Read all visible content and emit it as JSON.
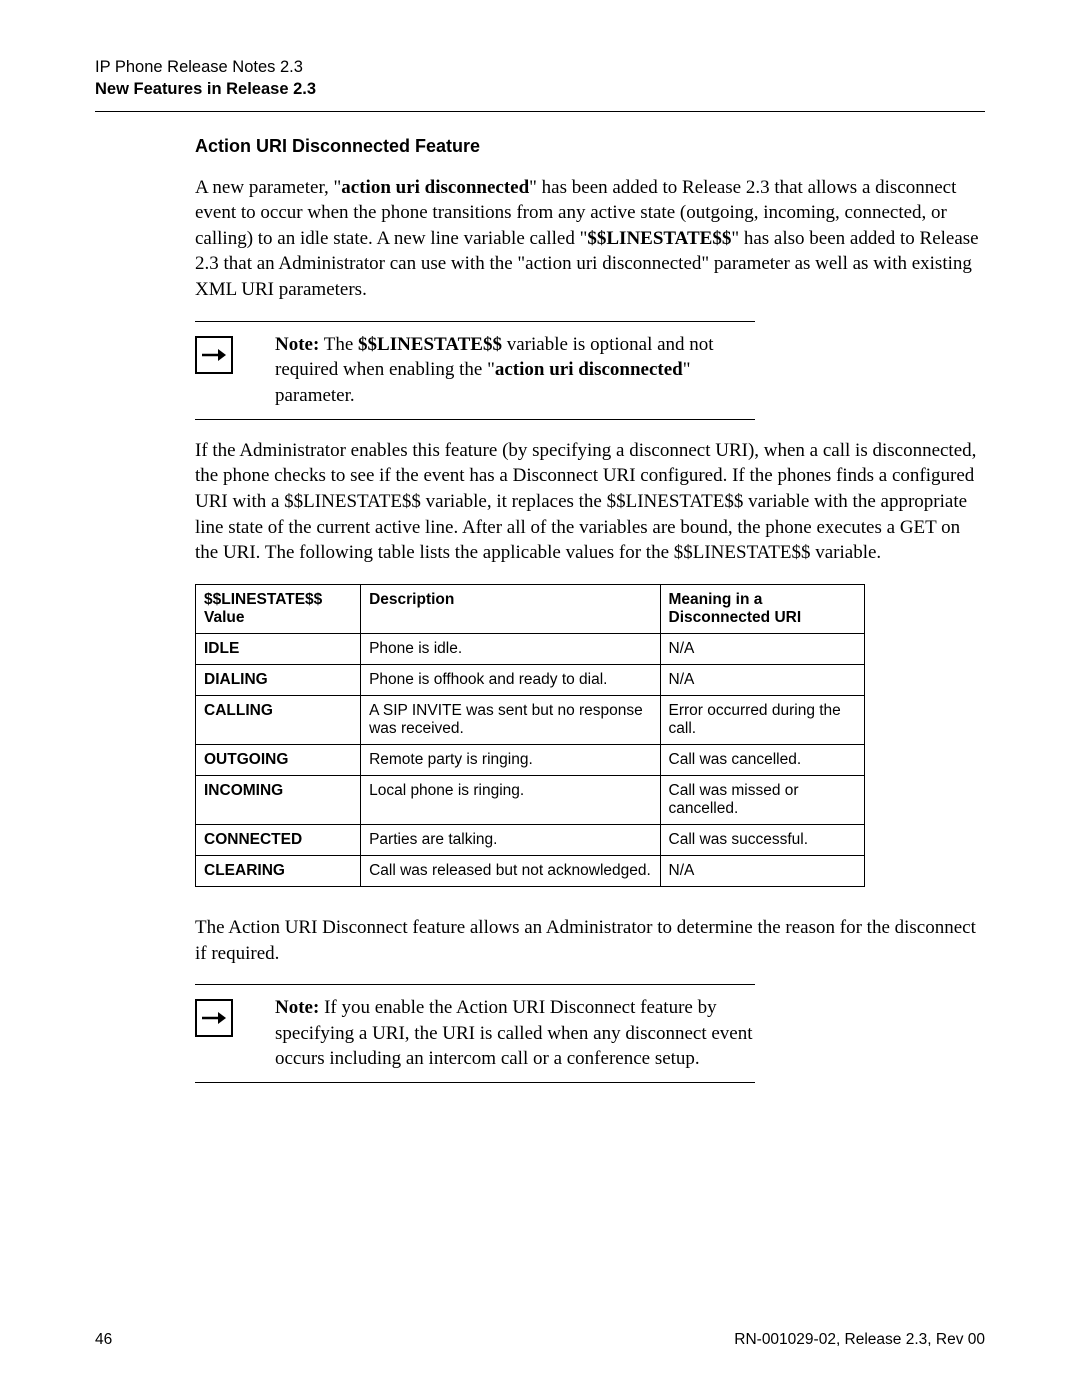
{
  "header": {
    "line1": "IP Phone Release Notes 2.3",
    "line2": "New Features in Release 2.3"
  },
  "section_title": "Action URI Disconnected Feature",
  "para1": {
    "t1": "A new parameter, \"",
    "b1": "action uri disconnected",
    "t2": "\" has been added to Release 2.3 that allows a disconnect event to occur when the phone transitions from any active state (outgoing, incoming, connected, or calling) to an idle state. A new line variable called \"",
    "b2": "$$LINESTATE$$",
    "t3": "\" has also been added to Release 2.3 that an Administrator can use with the \"action uri disconnected\" parameter as well as with existing XML URI parameters."
  },
  "note1": {
    "label": "Note:",
    "t1": " The ",
    "b1": "$$LINESTATE$$",
    "t2": " variable is optional and not required when enabling the \"",
    "b2": "action uri disconnected",
    "t3": "\" parameter."
  },
  "para2": "If the Administrator enables this feature (by specifying a disconnect URI), when a call is disconnected, the phone checks to see if the event has a Disconnect URI configured. If the phones finds a configured URI with a $$LINESTATE$$ variable, it replaces the $$LINESTATE$$ variable with the appropriate line state of the current active line. After all of the variables are bound, the phone executes a GET on the URI. The following table lists the applicable values for the $$LINESTATE$$ variable.",
  "table": {
    "headers": [
      "$$LINESTATE$$ Value",
      "Description",
      "Meaning in a Disconnected URI"
    ],
    "rows": [
      {
        "value": "IDLE",
        "desc": "Phone is idle.",
        "meaning": "N/A",
        "center": true
      },
      {
        "value": "DIALING",
        "desc": "Phone is offhook and ready to dial.",
        "meaning": "N/A",
        "center": true
      },
      {
        "value": "CALLING",
        "desc": "A SIP INVITE was sent but no response was received.",
        "meaning": "Error occurred during the call.",
        "center": false
      },
      {
        "value": "OUTGOING",
        "desc": "Remote party is ringing.",
        "meaning": "Call was cancelled.",
        "center": false
      },
      {
        "value": "INCOMING",
        "desc": "Local phone is ringing.",
        "meaning": "Call was missed or cancelled.",
        "center": false
      },
      {
        "value": "CONNECTED",
        "desc": "Parties are talking.",
        "meaning": "Call was successful.",
        "center": false
      },
      {
        "value": "CLEARING",
        "desc": "Call was released but not acknowledged.",
        "meaning": "N/A",
        "center": true
      }
    ]
  },
  "para3": "The Action URI Disconnect feature allows an Administrator to determine the reason for the disconnect if required.",
  "note2": {
    "label": "Note:",
    "text": " If you enable the Action URI Disconnect feature by specifying a URI, the URI is called when any disconnect event occurs including an intercom call or a conference setup."
  },
  "footer": {
    "page": "46",
    "doc": "RN-001029-02, Release 2.3, Rev 00"
  }
}
